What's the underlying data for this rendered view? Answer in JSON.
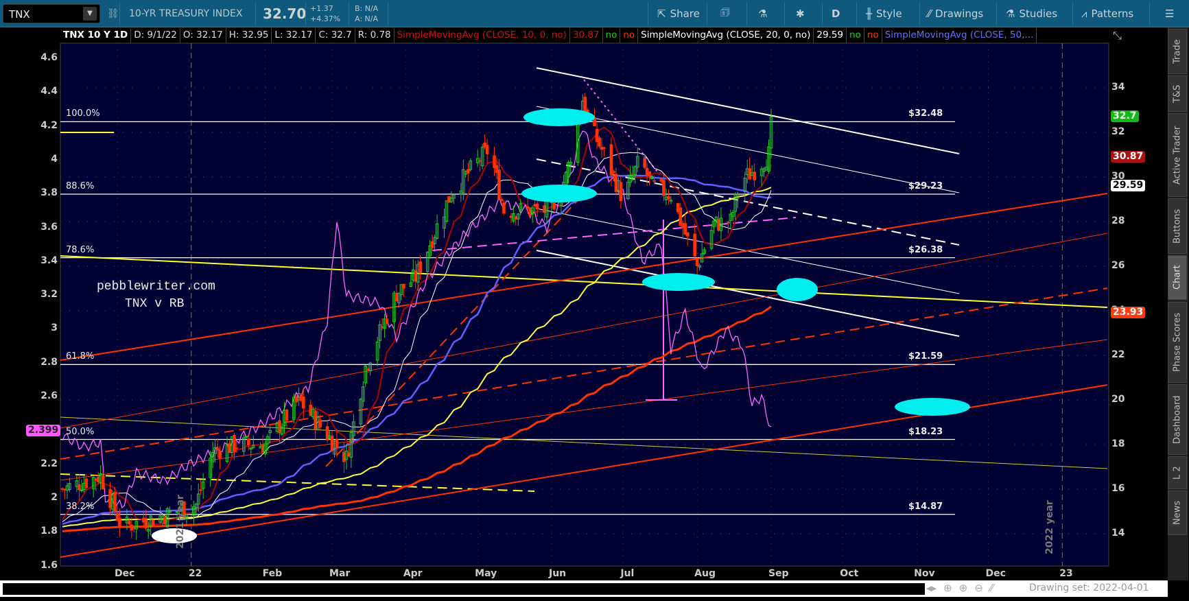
{
  "toolbar": {
    "symbol": "TNX",
    "description": "10-YR TREASURY INDEX",
    "last": "32.70",
    "change": "+1.37",
    "change_pct": "+4.37%",
    "bid": "B: N/A",
    "ask": "A: N/A",
    "buttons": {
      "share": "Share",
      "period": "D",
      "style": "Style",
      "drawings": "Drawings",
      "studies": "Studies",
      "patterns": "Patterns"
    }
  },
  "infobar": {
    "title": "TNX 10 Y 1D",
    "date": "D: 9/1/22",
    "open": "O: 32.17",
    "high": "H: 32.95",
    "low": "L: 32.17",
    "close": "C: 32.7",
    "range": "R: 0.78",
    "study1": "SimpleMovingAvg (CLOSE, 10, 0, no)",
    "study1_val": "30.87",
    "study2": "SimpleMovingAvg (CLOSE, 20, 0, no)",
    "study2_val": "29.59",
    "study3": "SimpleMovingAvg (CLOSE, 50,...",
    "no": "no"
  },
  "tabs": [
    "Trade",
    "T&S",
    "Active Trader",
    "Buttons",
    "Chart",
    "Phase Scores",
    "Dashboard",
    "L 2",
    "News"
  ],
  "statusbar": {
    "drawing_set": "Drawing set: 2022-04-01"
  },
  "colors": {
    "bg": "#000033",
    "up": "#22cc22",
    "down": "#ff3300",
    "sma10": "#b00000",
    "sma20": "#ffffff",
    "sma50": "#6060ff",
    "sma100": "#ffff33",
    "sma200": "#ff3300",
    "rb": "#ff66ff"
  },
  "chart_data": {
    "type": "candlestick",
    "right_axis": {
      "ticks": [
        "14",
        "16",
        "18",
        "20",
        "22",
        "24",
        "26",
        "28",
        "30",
        "32",
        "34"
      ],
      "range": [
        13.4,
        35.4
      ]
    },
    "left_axis": {
      "ticks": [
        "1.6",
        "1.8",
        "2",
        "2.2",
        "2.4",
        "2.6",
        "2.8",
        "3",
        "3.2",
        "3.4",
        "3.6",
        "3.8",
        "4",
        "4.2",
        "4.4",
        "4.6"
      ],
      "range": [
        1.6,
        4.7
      ]
    },
    "x_labels": [
      {
        "label": "Dec",
        "day": 0
      },
      {
        "label": "22",
        "day": 31
      },
      {
        "label": "Feb",
        "day": 62
      },
      {
        "label": "Mar",
        "day": 90
      },
      {
        "label": "Apr",
        "day": 121
      },
      {
        "label": "May",
        "day": 151
      },
      {
        "label": "Jun",
        "day": 182
      },
      {
        "label": "Jul",
        "day": 212
      },
      {
        "label": "Aug",
        "day": 243
      },
      {
        "label": "Sep",
        "day": 274
      },
      {
        "label": "Oct",
        "day": 304
      },
      {
        "label": "Nov",
        "day": 335
      },
      {
        "label": "Dec",
        "day": 365
      },
      {
        "label": "23",
        "day": 396
      }
    ],
    "price_path": [
      [
        -23,
        16.0
      ],
      [
        -7,
        16.6
      ],
      [
        2,
        14.3
      ],
      [
        19,
        14.8
      ],
      [
        33,
        15.3
      ],
      [
        40,
        17.7
      ],
      [
        50,
        18.0
      ],
      [
        62,
        18.0
      ],
      [
        76,
        20.0
      ],
      [
        96,
        17.4
      ],
      [
        104,
        21.5
      ],
      [
        117,
        24.8
      ],
      [
        125,
        25.5
      ],
      [
        140,
        29.3
      ],
      [
        156,
        31.3
      ],
      [
        162,
        28.5
      ],
      [
        181,
        28.5
      ],
      [
        188,
        30.0
      ],
      [
        195,
        33.5
      ],
      [
        198,
        32.3
      ],
      [
        205,
        30.8
      ],
      [
        212,
        29.0
      ],
      [
        219,
        30.8
      ],
      [
        224,
        29.6
      ],
      [
        232,
        29.2
      ],
      [
        243,
        26.0
      ],
      [
        250,
        27.9
      ],
      [
        257,
        28.0
      ],
      [
        261,
        29.8
      ],
      [
        268,
        30.4
      ],
      [
        273,
        31.0
      ],
      [
        274,
        32.7
      ]
    ],
    "rb_path": [
      [
        -23,
        2.37
      ],
      [
        -14,
        2.3
      ],
      [
        -7,
        2.33
      ],
      [
        -5,
        2.0
      ],
      [
        2,
        1.95
      ],
      [
        8,
        2.15
      ],
      [
        20,
        2.1
      ],
      [
        30,
        2.2
      ],
      [
        45,
        2.3
      ],
      [
        62,
        2.45
      ],
      [
        80,
        2.65
      ],
      [
        88,
        3.05
      ],
      [
        92,
        3.65
      ],
      [
        96,
        3.2
      ],
      [
        110,
        3.15
      ],
      [
        117,
        2.95
      ],
      [
        130,
        3.3
      ],
      [
        145,
        3.55
      ],
      [
        160,
        3.75
      ],
      [
        172,
        3.7
      ],
      [
        180,
        3.6
      ],
      [
        190,
        3.9
      ],
      [
        195,
        4.2
      ],
      [
        200,
        4.0
      ],
      [
        212,
        3.8
      ],
      [
        220,
        3.4
      ],
      [
        228,
        3.5
      ],
      [
        232,
        2.88
      ],
      [
        238,
        3.1
      ],
      [
        245,
        2.75
      ],
      [
        255,
        3.0
      ],
      [
        262,
        2.9
      ],
      [
        266,
        2.55
      ],
      [
        270,
        2.6
      ],
      [
        274,
        2.4
      ]
    ],
    "fib_levels": [
      {
        "pct": "100.0%",
        "price": "$32.48",
        "value": 32.48
      },
      {
        "pct": "88.6%",
        "price": "$29.23",
        "value": 29.23
      },
      {
        "pct": "78.6%",
        "price": "$26.38",
        "value": 26.38
      },
      {
        "pct": "61.8%",
        "price": "$21.59",
        "value": 21.59
      },
      {
        "pct": "50.0%",
        "price": "$18.23",
        "value": 18.23
      },
      {
        "pct": "38.2%",
        "price": "$14.87",
        "value": 14.87
      }
    ],
    "badges": {
      "last": "32.7",
      "sma10": "30.87",
      "sma20": "29.59",
      "sma200": "23.93",
      "rb": "2.399"
    },
    "annotations": {
      "site": "pebblewriter.com",
      "pair": "TNX v RB",
      "year2021": "2021 year",
      "year2022": "2022 year"
    }
  }
}
